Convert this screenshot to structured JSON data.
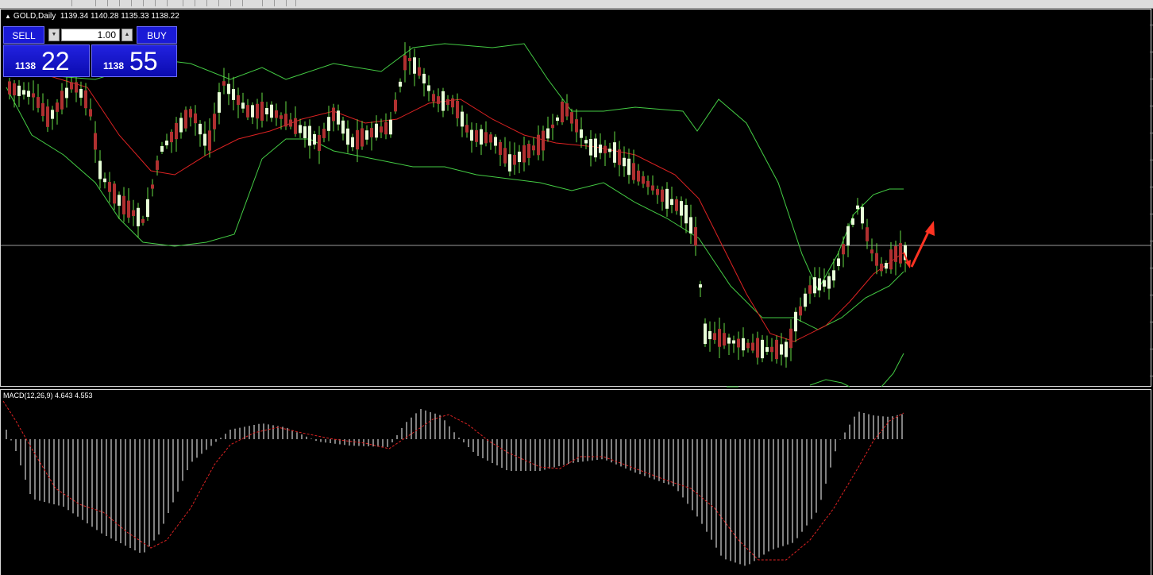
{
  "chart_header": {
    "symbol_timeframe": "GOLD,Daily",
    "ohlc": "1139.34 1140.28 1135.33 1138.22"
  },
  "trade_panel": {
    "sell_label": "SELL",
    "buy_label": "BUY",
    "lot_value": "1.00",
    "sell_price_prefix": "1138",
    "sell_price_big": "22",
    "buy_price_prefix": "1138",
    "buy_price_big": "55"
  },
  "indicator": {
    "macd_label": "MACD(12,26,9) 4.643 4.553"
  },
  "colors": {
    "background": "#000000",
    "bull_candle": "#e8ffd8",
    "bear_candle": "#b03030",
    "wick": "#66dd44",
    "bollinger": "#44cc44",
    "moving_average": "#dd2222",
    "macd_histogram": "#ffffff",
    "macd_signal": "#dd2222",
    "annotation_arrow": "#ff3322",
    "trade_button": "#1a1ad6"
  },
  "chart_data": {
    "type": "candlestick",
    "symbol": "GOLD",
    "timeframe": "Daily",
    "last_price": 1138.22,
    "ohlc_current": {
      "open": 1139.34,
      "high": 1140.28,
      "low": 1135.33,
      "close": 1138.22
    },
    "indicators": [
      "Bollinger Bands",
      "Moving Average",
      "MACD(12,26,9)"
    ],
    "macd": {
      "main": 4.643,
      "signal": 4.553
    },
    "notes": "Annotation arrows drawn: short dip then upward arrow at the last bar"
  }
}
